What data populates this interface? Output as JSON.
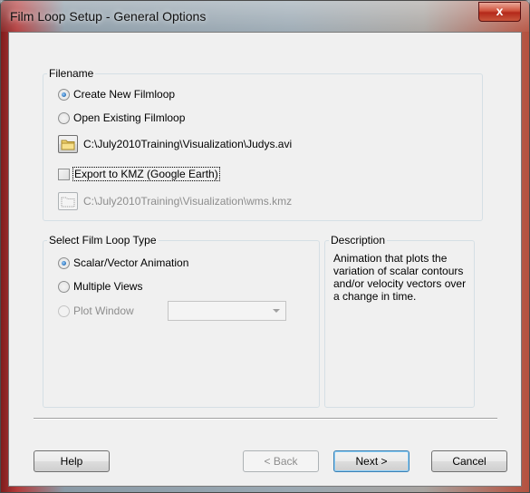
{
  "window": {
    "title": "Film Loop Setup - General Options",
    "close_glyph": "x"
  },
  "filename_group": {
    "legend": "Filename",
    "options": [
      {
        "label": "Create New Filmloop",
        "checked": true
      },
      {
        "label": "Open Existing Filmloop",
        "checked": false
      }
    ],
    "file_path": "C:\\July2010Training\\Visualization\\Judys.avi",
    "export_checkbox": {
      "label": "Export to KMZ (Google Earth)",
      "checked": false
    },
    "kmz_path": "C:\\July2010Training\\Visualization\\wms.kmz"
  },
  "type_group": {
    "legend": "Select Film Loop Type",
    "options": [
      {
        "label": "Scalar/Vector Animation",
        "checked": true,
        "enabled": true
      },
      {
        "label": "Multiple Views",
        "checked": false,
        "enabled": true
      },
      {
        "label": "Plot Window",
        "checked": false,
        "enabled": false
      }
    ],
    "plot_window_select_value": ""
  },
  "description_group": {
    "legend": "Description",
    "text": "Animation that plots the variation of scalar contours and/or velocity vectors over a change in time."
  },
  "buttons": {
    "help": "Help",
    "back": "< Back",
    "next": "Next >",
    "cancel": "Cancel"
  },
  "icons": {
    "folder": "folder-open-icon",
    "folder_disabled": "folder-icon",
    "combo_arrow": "chevron-down-icon"
  },
  "colors": {
    "accent": "#3c7fb1",
    "folder": "#f2d470",
    "close": "#c9553c"
  }
}
